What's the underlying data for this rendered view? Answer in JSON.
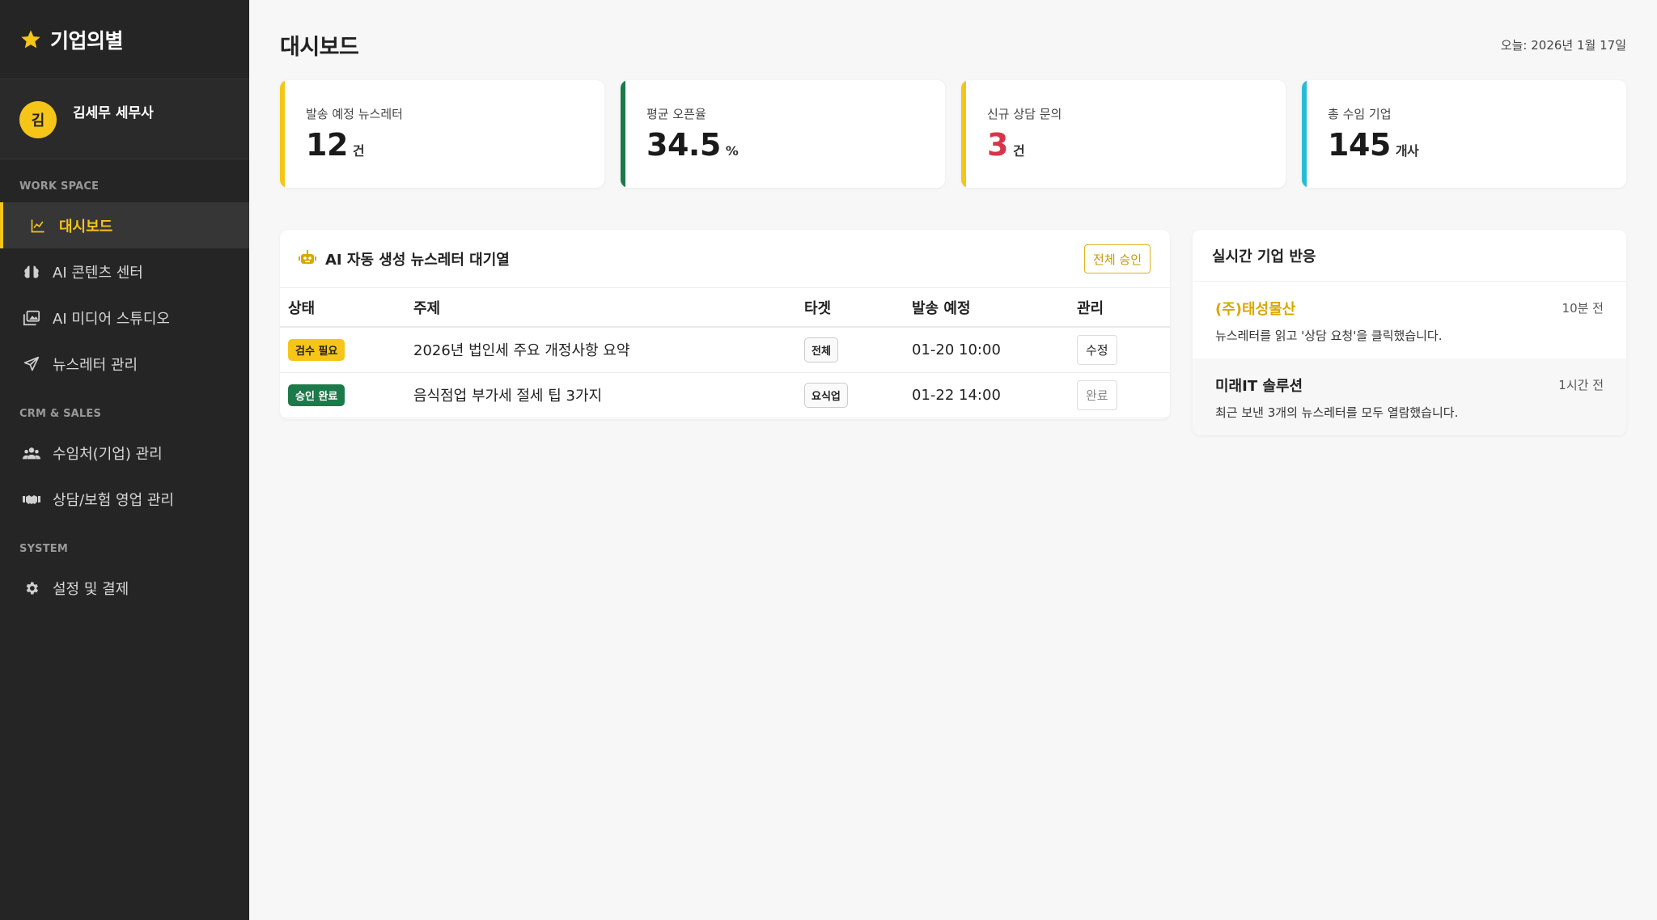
{
  "brand": {
    "name": "기업의별",
    "icon": "star-icon",
    "accent": "#f5c518"
  },
  "profile": {
    "avatar_initial": "김",
    "name": "김세무 세무사"
  },
  "sidebar": {
    "sections": [
      {
        "title": "WORK SPACE",
        "items": [
          {
            "label": "대시보드",
            "icon": "chart-line-icon",
            "active": true
          },
          {
            "label": "AI 콘텐츠 센터",
            "icon": "brain-icon"
          },
          {
            "label": "AI 미디어 스튜디오",
            "icon": "photo-gallery-icon"
          },
          {
            "label": "뉴스레터 관리",
            "icon": "paper-plane-icon"
          }
        ]
      },
      {
        "title": "CRM & SALES",
        "items": [
          {
            "label": "수임처(기업) 관리",
            "icon": "users-icon"
          },
          {
            "label": "상담/보험 영업 관리",
            "icon": "handshake-icon"
          }
        ]
      },
      {
        "title": "SYSTEM",
        "items": [
          {
            "label": "설정 및 결제",
            "icon": "gear-icon"
          }
        ]
      }
    ]
  },
  "header": {
    "title": "대시보드",
    "today": "오늘: 2026년 1월 17일"
  },
  "stats": [
    {
      "label": "발송 예정 뉴스레터",
      "value": "12",
      "unit": "건",
      "color": "#f5c518"
    },
    {
      "label": "평균 오픈율",
      "value": "34.5",
      "unit": "%",
      "color": "#1c7a4a"
    },
    {
      "label": "신규 상담 문의",
      "value": "3",
      "unit": "건",
      "color": "#f5c518",
      "value_color": "#d9334a"
    },
    {
      "label": "총 수임 기업",
      "value": "145",
      "unit": "개사",
      "color": "#26bcd6"
    }
  ],
  "queue": {
    "title": "AI 자동 생성 뉴스레터 대기열",
    "icon": "robot-icon",
    "approve_all_label": "전체 승인",
    "columns": [
      "상태",
      "주제",
      "타겟",
      "발송 예정",
      "관리"
    ],
    "rows": [
      {
        "status": "검수 필요",
        "status_type": "warn",
        "subject": "2026년 법인세 주요 개정사항 요약",
        "target": "전체",
        "scheduled": "01-20 10:00",
        "action": "수정"
      },
      {
        "status": "승인 완료",
        "status_type": "ok",
        "subject": "음식점업 부가세 절세 팁 3가지",
        "target": "요식업",
        "scheduled": "01-22 14:00",
        "action": "완료"
      }
    ]
  },
  "realtime": {
    "title": "실시간 기업 반응",
    "items": [
      {
        "company": "(주)태성물산",
        "time": "10분 전",
        "message": "뉴스레터를 읽고 '상담 요청'을 클릭했습니다."
      },
      {
        "company": "미래IT 솔루션",
        "time": "1시간 전",
        "message": "최근 보낸 3개의 뉴스레터를 모두 열람했습니다."
      }
    ]
  }
}
